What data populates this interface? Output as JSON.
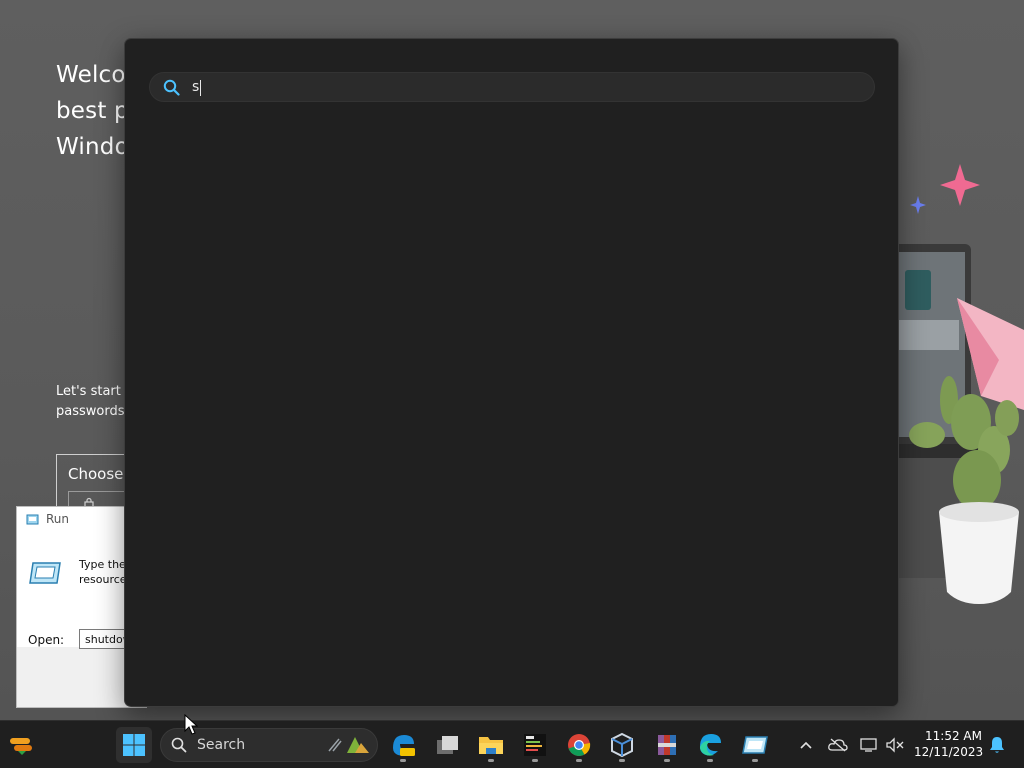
{
  "background_app": {
    "welcome_lines": [
      "Welco",
      "best p",
      "Windo"
    ],
    "intro_lines": [
      "Let's start b",
      "passwords,"
    ],
    "choose_label": "Choose"
  },
  "run_dialog": {
    "title": "Run",
    "description_lines": [
      "Type the",
      "resource"
    ],
    "open_label": "Open:",
    "open_value": "shutdow"
  },
  "search_overlay": {
    "query": "s",
    "accent": "#4cc2ff",
    "panel_bg": "#202020"
  },
  "taskbar": {
    "search_label": "Search",
    "pinned_apps": [
      {
        "name": "windows-start",
        "icon": "windows-logo-icon",
        "active": true
      },
      {
        "name": "edge-canary",
        "icon": "edge-pre-icon"
      },
      {
        "name": "task-view",
        "icon": "task-view-icon"
      },
      {
        "name": "file-explorer",
        "icon": "folder-icon"
      },
      {
        "name": "ide",
        "icon": "ide-icon"
      },
      {
        "name": "chrome",
        "icon": "chrome-icon"
      },
      {
        "name": "virtualbox",
        "icon": "virtualbox-icon"
      },
      {
        "name": "archive-tool",
        "icon": "archive-icon"
      },
      {
        "name": "edge",
        "icon": "edge-icon"
      },
      {
        "name": "run",
        "icon": "run-icon"
      }
    ],
    "clock": {
      "time": "11:52 AM",
      "date": "12/11/2023"
    }
  }
}
